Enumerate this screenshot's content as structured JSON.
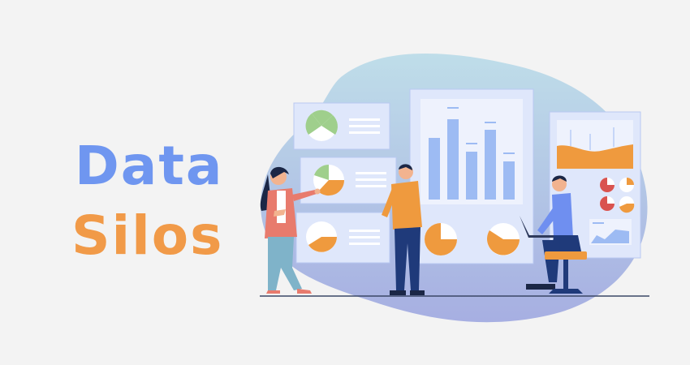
{
  "title": {
    "line1": "Data",
    "line2": "Silos"
  },
  "colors": {
    "background": "#f3f3f3",
    "title_line1": "#6f96f0",
    "title_line2": "#f19a48",
    "blob_top": "#b9dbe8",
    "blob_bottom": "#9ea7e0",
    "panel": "#dfe7fb",
    "panel_border": "#b9c8f2",
    "bar": "#9dbbf3",
    "orange": "#ef9a3e",
    "green": "#9fcf8c",
    "red": "#d9534f",
    "shirt_blue": "#6f8ff0",
    "pants_navy": "#1f3a7a",
    "woman_jacket": "#e87b6d",
    "woman_pants": "#7fb3c9",
    "hair": "#1b2746",
    "skin": "#f2b38f"
  },
  "icons": [
    "pie-chart-icon",
    "bar-chart-icon",
    "area-chart-icon",
    "laptop-icon"
  ]
}
